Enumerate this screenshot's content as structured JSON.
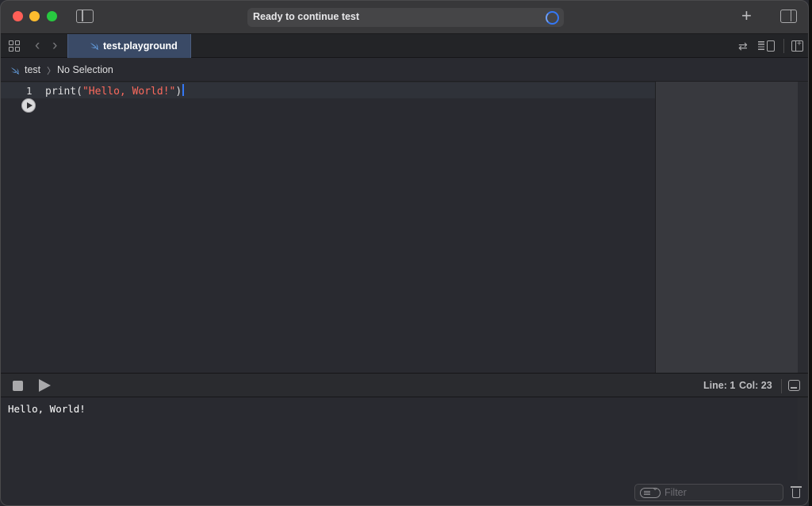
{
  "titlebar": {
    "status": "Ready to continue test"
  },
  "tabbar": {
    "active_tab": "test.playground"
  },
  "breadcrumb": {
    "project": "test",
    "selection": "No Selection"
  },
  "editor": {
    "lines": [
      {
        "number": "1",
        "fn": "print(",
        "string": "\"Hello, World!\"",
        "close": ")"
      }
    ]
  },
  "debugbar": {
    "line": "Line: 1",
    "col": "Col: 23"
  },
  "console": {
    "output": "Hello, World!",
    "filter_placeholder": "Filter"
  },
  "colors": {
    "accent": "#3478f6",
    "string": "#fc6a5d",
    "tab_active": "#3a4a66",
    "close": "#ff5f57",
    "minimize": "#febc2e",
    "maximize": "#28c840"
  },
  "icons": [
    "close-icon",
    "minimize-icon",
    "maximize-icon",
    "sidebar-toggle-icon",
    "spinner-icon",
    "plus-icon",
    "inspector-icon",
    "grid-icon",
    "chevron-left-icon",
    "chevron-right-icon",
    "swift-icon",
    "swap-icon",
    "list-icon",
    "add-editor-icon",
    "play-circle-icon",
    "stop-icon",
    "play-icon",
    "console-toggle-icon",
    "filter-icon",
    "trash-icon"
  ]
}
